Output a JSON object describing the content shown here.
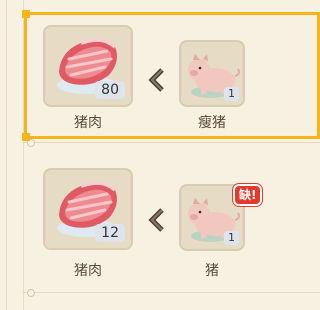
{
  "recipes": [
    {
      "selected": true,
      "output": {
        "name": "猪肉",
        "count": "80",
        "icon": "meat-icon"
      },
      "input": {
        "name": "瘦猪",
        "count": "1",
        "icon": "pig-icon"
      }
    },
    {
      "selected": false,
      "output": {
        "name": "猪肉",
        "count": "12",
        "icon": "meat-icon"
      },
      "input": {
        "name": "猪",
        "count": "1",
        "icon": "pig-icon",
        "badge": "缺!"
      }
    }
  ],
  "colors": {
    "selection": "#f5b41a",
    "background": "#f7f1e2",
    "slot": "#e6dcc5",
    "badge": "#e53a2a",
    "text": "#5a4b3a"
  }
}
